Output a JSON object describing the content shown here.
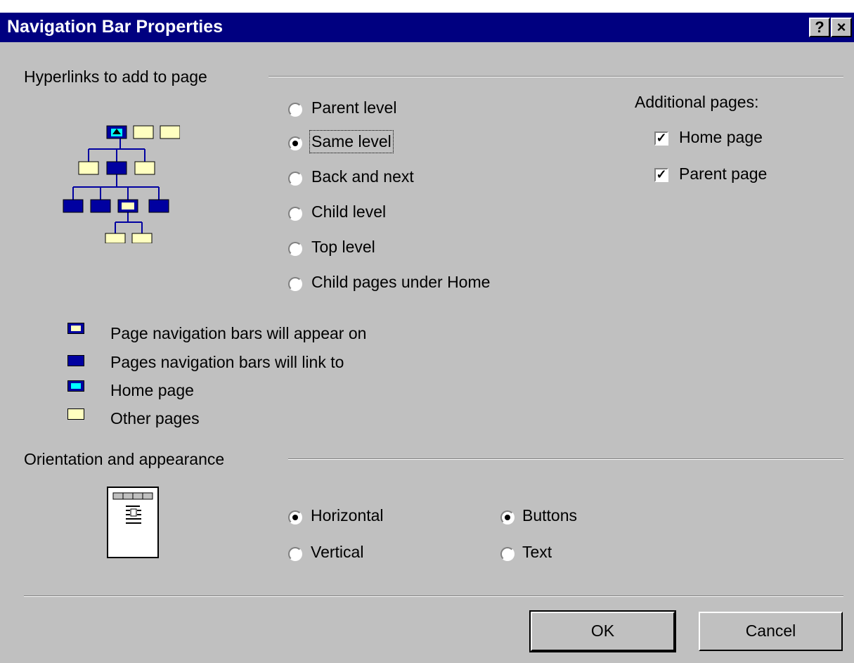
{
  "window": {
    "title": "Navigation Bar Properties",
    "help_button": "?",
    "close_button": "×"
  },
  "hyperlinks": {
    "group_label": "Hyperlinks to add to page",
    "options": [
      {
        "label": "Parent level",
        "selected": false
      },
      {
        "label": "Same level",
        "selected": true
      },
      {
        "label": "Back and next",
        "selected": false
      },
      {
        "label": "Child level",
        "selected": false
      },
      {
        "label": "Top level",
        "selected": false
      },
      {
        "label": "Child pages under Home",
        "selected": false
      }
    ]
  },
  "additional": {
    "label": "Additional pages:",
    "home_page": {
      "label": "Home page",
      "checked": true
    },
    "parent_page": {
      "label": "Parent page",
      "checked": true
    }
  },
  "legend": [
    {
      "label": "Page navigation bars will appear on",
      "icon": "current-page-icon"
    },
    {
      "label": "Pages navigation bars will link to",
      "icon": "linked-page-icon"
    },
    {
      "label": "Home page",
      "icon": "home-page-icon"
    },
    {
      "label": "Other pages",
      "icon": "other-page-icon"
    }
  ],
  "orientation": {
    "group_label": "Orientation and appearance",
    "horizontal": {
      "label": "Horizontal",
      "selected": true
    },
    "vertical": {
      "label": "Vertical",
      "selected": false
    },
    "buttons": {
      "label": "Buttons",
      "selected": true
    },
    "text": {
      "label": "Text",
      "selected": false
    }
  },
  "actions": {
    "ok": "OK",
    "cancel": "Cancel"
  },
  "colors": {
    "titlebar": "#000080",
    "face": "#c0c0c0",
    "linked_page": "#0000a0",
    "other_page": "#ffffc0",
    "home_icon": "#00ffff"
  }
}
